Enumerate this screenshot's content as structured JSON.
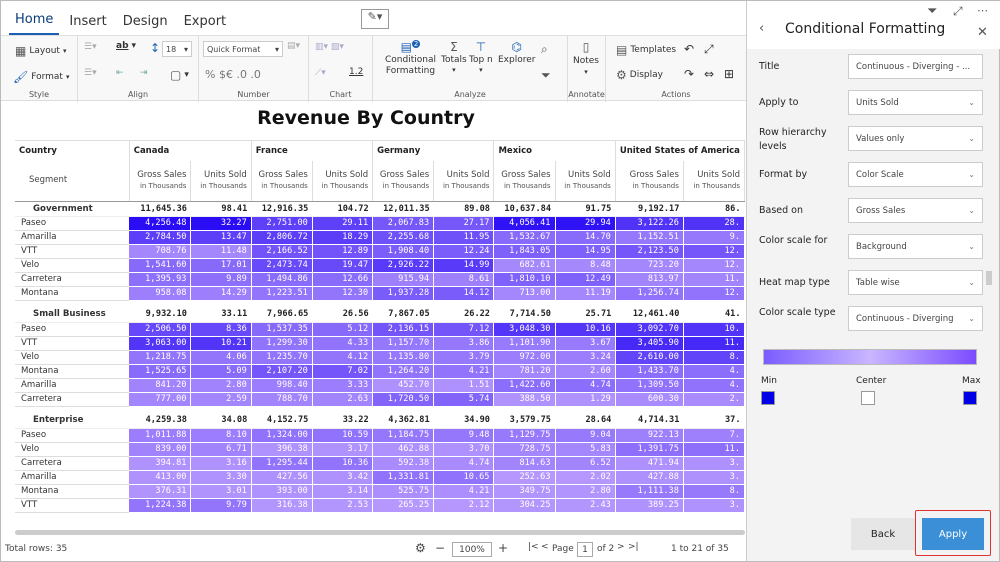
{
  "tabs": [
    "Home",
    "Insert",
    "Design",
    "Export"
  ],
  "ribbon": {
    "layout_label": "Layout",
    "format_label": "Format",
    "font_size": "18",
    "quick_format": "Quick Format",
    "conditional_formatting": "Conditional",
    "conditional_formatting2": "Formatting",
    "totals": "Totals",
    "topn": "Top n",
    "explorer": "Explorer",
    "notes": "Notes",
    "templates": "Templates",
    "display": "Display",
    "decimals": "1.2",
    "badge": "2",
    "groups": [
      "Style",
      "Align",
      "Number",
      "Chart",
      "Analyze",
      "Annotate",
      "Actions"
    ]
  },
  "report": {
    "title": "Revenue By Country",
    "row_header": "Country",
    "segment_header": "Segment",
    "countries": [
      "Canada",
      "France",
      "Germany",
      "Mexico",
      "United States of America"
    ],
    "measure1": "Gross Sales",
    "measure2": "Units Sold",
    "unit": "in Thousands",
    "groups": [
      {
        "name": "Government",
        "totals": [
          "11,645.36",
          "98.41",
          "12,916.35",
          "104.72",
          "12,011.35",
          "89.08",
          "10,637.84",
          "91.75",
          "9,192.17",
          "86."
        ],
        "rows": [
          {
            "name": "Paseo",
            "values": [
              "4,256.48",
              "32.27",
              "2,751.00",
              "29.11",
              "2,067.83",
              "27.17",
              "4,056.41",
              "29.94",
              "3,122.26",
              "28."
            ]
          },
          {
            "name": "Amarilla",
            "values": [
              "2,784.50",
              "13.47",
              "2,806.72",
              "18.29",
              "2,255.68",
              "11.95",
              "1,532.67",
              "14.70",
              "1,152.51",
              "9."
            ]
          },
          {
            "name": "VTT",
            "values": [
              "708.76",
              "11.48",
              "2,166.52",
              "12.89",
              "1,908.40",
              "12.24",
              "1,843.05",
              "14.95",
              "2,123.50",
              "12."
            ]
          },
          {
            "name": "Velo",
            "values": [
              "1,541.60",
              "17.01",
              "2,473.74",
              "19.47",
              "2,926.22",
              "14.99",
              "682.61",
              "8.48",
              "723.20",
              "12."
            ]
          },
          {
            "name": "Carretera",
            "values": [
              "1,395.93",
              "9.89",
              "1,494.86",
              "12.66",
              "915.94",
              "8.61",
              "1,810.10",
              "12.49",
              "813.97",
              "11."
            ]
          },
          {
            "name": "Montana",
            "values": [
              "958.08",
              "14.29",
              "1,223.51",
              "12.30",
              "1,937.28",
              "14.12",
              "713.00",
              "11.19",
              "1,256.74",
              "12."
            ]
          }
        ]
      },
      {
        "name": "Small Business",
        "totals": [
          "9,932.10",
          "33.11",
          "7,966.65",
          "26.56",
          "7,867.05",
          "26.22",
          "7,714.50",
          "25.71",
          "12,461.40",
          "41."
        ],
        "rows": [
          {
            "name": "Paseo",
            "values": [
              "2,506.50",
              "8.36",
              "1,537.35",
              "5.12",
              "2,136.15",
              "7.12",
              "3,048.30",
              "10.16",
              "3,092.70",
              "10."
            ]
          },
          {
            "name": "VTT",
            "values": [
              "3,063.00",
              "10.21",
              "1,299.30",
              "4.33",
              "1,157.70",
              "3.86",
              "1,101.90",
              "3.67",
              "3,405.90",
              "11."
            ]
          },
          {
            "name": "Velo",
            "values": [
              "1,218.75",
              "4.06",
              "1,235.70",
              "4.12",
              "1,135.80",
              "3.79",
              "972.00",
              "3.24",
              "2,610.00",
              "8."
            ]
          },
          {
            "name": "Montana",
            "values": [
              "1,525.65",
              "5.09",
              "2,107.20",
              "7.02",
              "1,264.20",
              "4.21",
              "781.20",
              "2.60",
              "1,433.70",
              "4."
            ]
          },
          {
            "name": "Amarilla",
            "values": [
              "841.20",
              "2.80",
              "998.40",
              "3.33",
              "452.70",
              "1.51",
              "1,422.60",
              "4.74",
              "1,309.50",
              "4."
            ]
          },
          {
            "name": "Carretera",
            "values": [
              "777.00",
              "2.59",
              "788.70",
              "2.63",
              "1,720.50",
              "5.74",
              "388.50",
              "1.29",
              "600.30",
              "2."
            ]
          }
        ]
      },
      {
        "name": "Enterprise",
        "totals": [
          "4,259.38",
          "34.08",
          "4,152.75",
          "33.22",
          "4,362.81",
          "34.90",
          "3,579.75",
          "28.64",
          "4,714.31",
          "37."
        ],
        "rows": [
          {
            "name": "Paseo",
            "values": [
              "1,011.88",
              "8.10",
              "1,324.00",
              "10.59",
              "1,184.75",
              "9.48",
              "1,129.75",
              "9.04",
              "922.13",
              "7."
            ]
          },
          {
            "name": "Velo",
            "values": [
              "839.00",
              "6.71",
              "396.38",
              "3.17",
              "462.88",
              "3.70",
              "728.75",
              "5.83",
              "1,391.75",
              "11."
            ]
          },
          {
            "name": "Carretera",
            "values": [
              "394.81",
              "3.16",
              "1,295.44",
              "10.36",
              "592.38",
              "4.74",
              "814.63",
              "6.52",
              "471.94",
              "3."
            ]
          },
          {
            "name": "Amarilla",
            "values": [
              "413.00",
              "3.30",
              "427.56",
              "3.42",
              "1,331.81",
              "10.65",
              "252.63",
              "2.02",
              "427.88",
              "3."
            ]
          },
          {
            "name": "Montana",
            "values": [
              "376.31",
              "3.01",
              "393.00",
              "3.14",
              "525.75",
              "4.21",
              "349.75",
              "2.80",
              "1,111.38",
              "8."
            ]
          },
          {
            "name": "VTT",
            "values": [
              "1,224.38",
              "9.79",
              "316.38",
              "2.53",
              "265.25",
              "2.12",
              "304.25",
              "2.43",
              "389.25",
              "3."
            ]
          }
        ]
      }
    ]
  },
  "footer": {
    "total_rows": "Total rows: 35",
    "zoom": "100%",
    "page_label": "Page",
    "page": "1",
    "of_pages": "of 2",
    "range": "1  to 21 of 35"
  },
  "panel": {
    "title": "Conditional Formatting",
    "fields": [
      {
        "label": "Title",
        "value": "Continuous - Diverging - ..."
      },
      {
        "label": "Apply to",
        "value": "Units Sold"
      },
      {
        "label": "Row hierarchy levels",
        "value": "Values only"
      },
      {
        "label": "Format by",
        "value": "Color Scale"
      },
      {
        "label": "Based on",
        "value": "Gross Sales"
      },
      {
        "label": "Color scale for",
        "value": "Background"
      },
      {
        "label": "Heat map type",
        "value": "Table wise"
      },
      {
        "label": "Color scale type",
        "value": "Continuous - Diverging"
      }
    ],
    "min_label": "Min",
    "center_label": "Center",
    "max_label": "Max",
    "min_color": "#0000e6",
    "center_color": "#ffffff",
    "max_color": "#0000e6",
    "back_label": "Back",
    "apply_label": "Apply"
  }
}
